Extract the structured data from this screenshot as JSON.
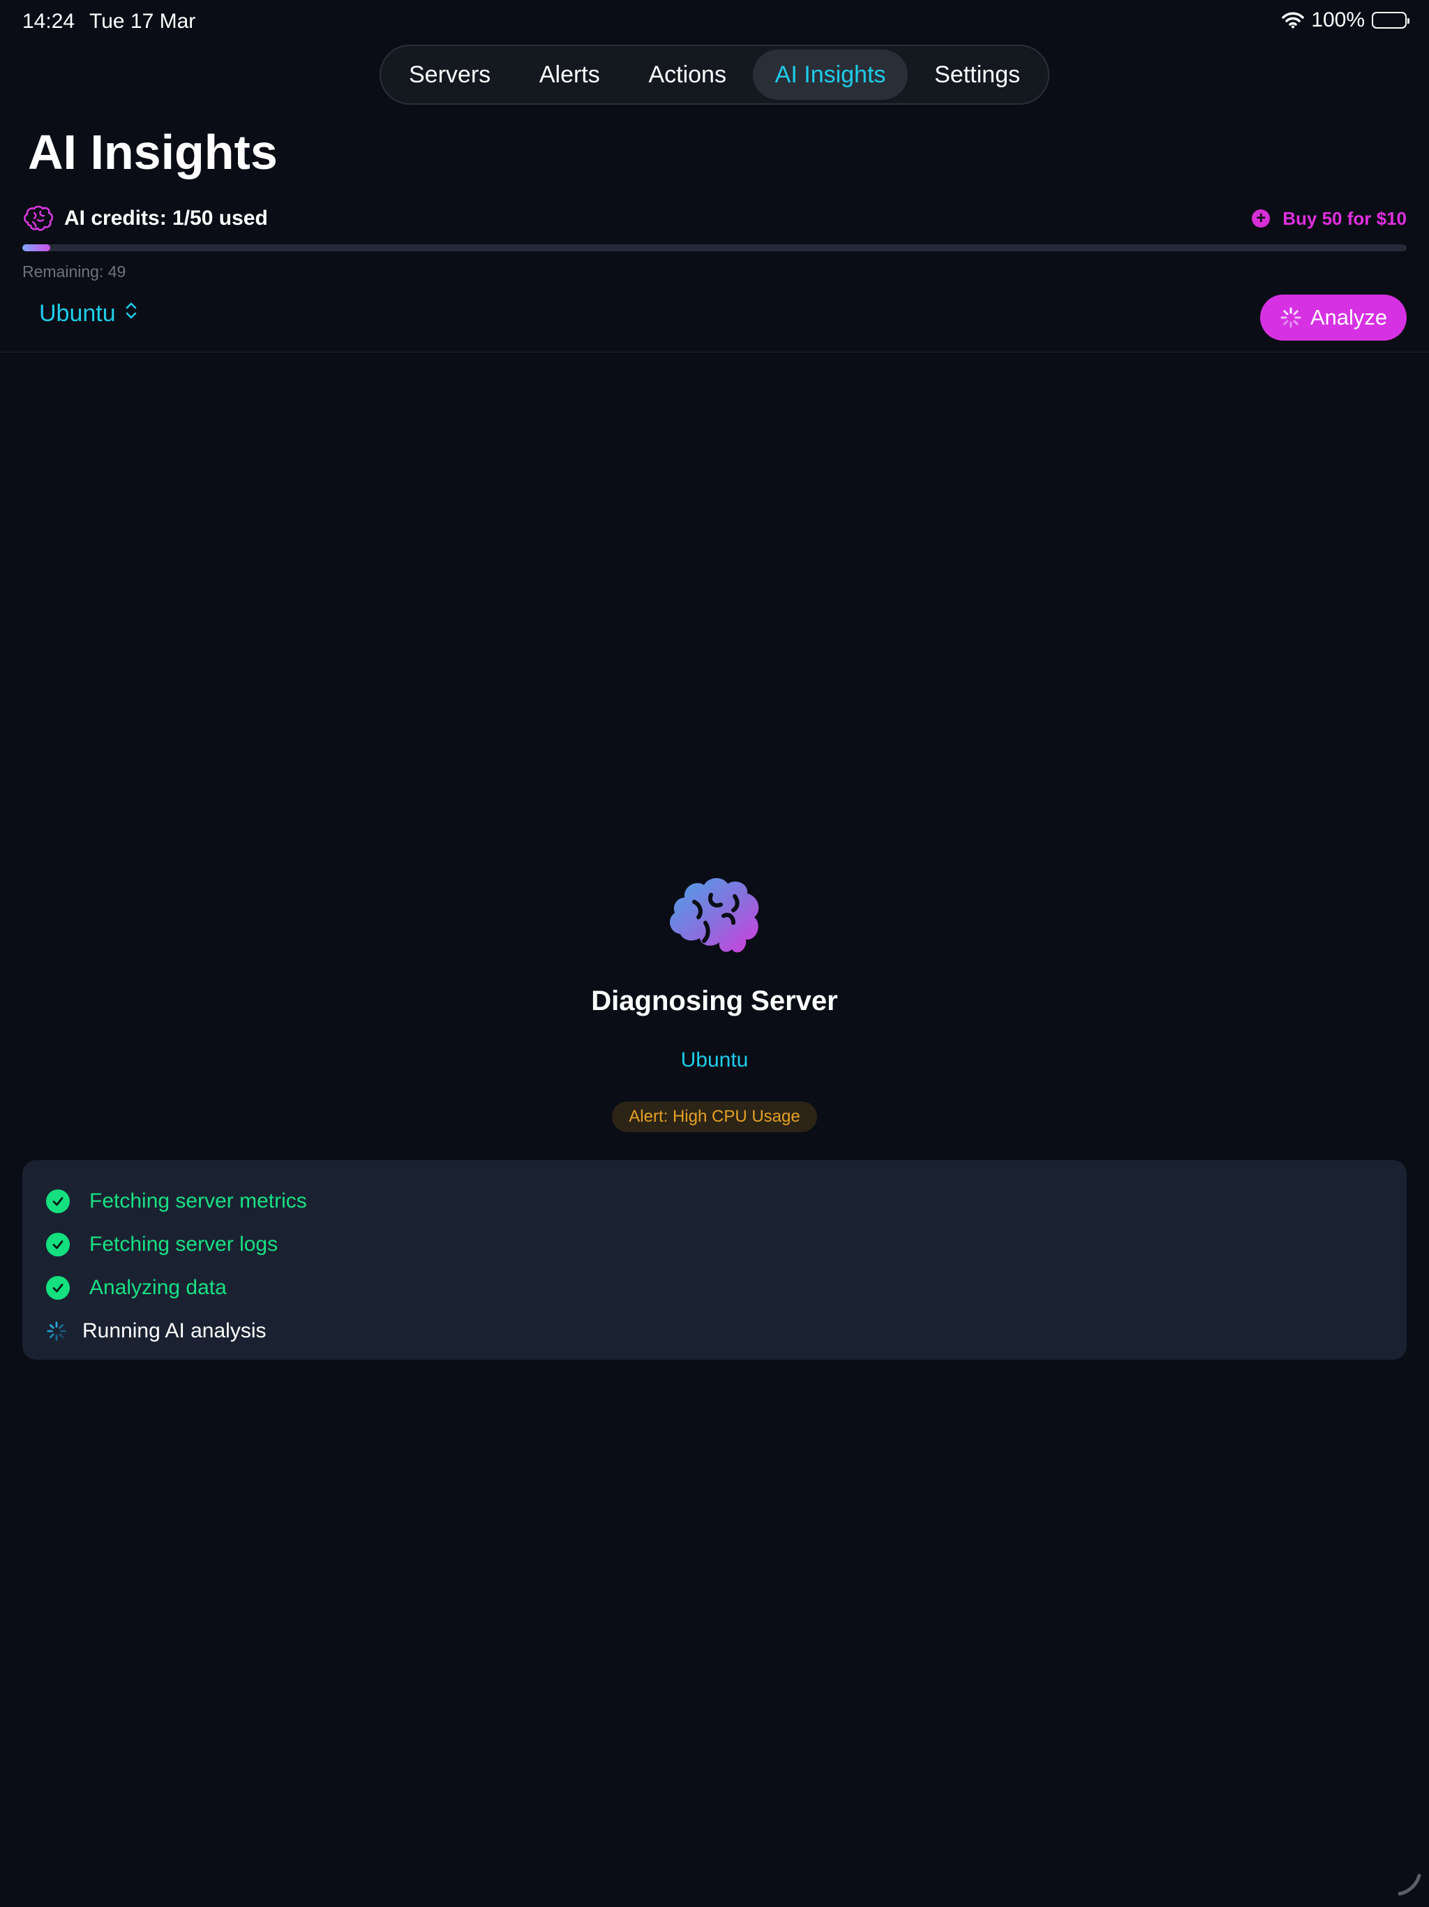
{
  "status_bar": {
    "time": "14:24",
    "date": "Tue 17 Mar",
    "battery": "100%"
  },
  "tabs": [
    {
      "label": "Servers",
      "active": false
    },
    {
      "label": "Alerts",
      "active": false
    },
    {
      "label": "Actions",
      "active": false
    },
    {
      "label": "AI Insights",
      "active": true
    },
    {
      "label": "Settings",
      "active": false
    }
  ],
  "page": {
    "title": "AI Insights"
  },
  "credits": {
    "label": "AI credits: 1/50 used",
    "buy_label": "Buy 50 for $10",
    "remaining": "Remaining: 49",
    "used": 1,
    "total": 50
  },
  "server_picker": {
    "selected": "Ubuntu"
  },
  "analyze_button": {
    "label": "Analyze"
  },
  "diagnosis": {
    "title": "Diagnosing Server",
    "server": "Ubuntu",
    "alert": "Alert: High CPU Usage"
  },
  "steps": [
    {
      "label": "Fetching server metrics",
      "status": "done"
    },
    {
      "label": "Fetching server logs",
      "status": "done"
    },
    {
      "label": "Analyzing data",
      "status": "done"
    },
    {
      "label": "Running AI analysis",
      "status": "running"
    }
  ],
  "colors": {
    "background": "#0a0d15",
    "accent_cyan": "#1ecdea",
    "accent_magenta": "#d631e3",
    "success_green": "#19e083",
    "alert_amber": "#e6a024",
    "card": "#1a2231"
  },
  "icons": {
    "wifi": "wifi-icon",
    "battery": "battery-icon",
    "credits": "brain-icon",
    "buy": "plus-circle-icon",
    "picker": "chevron-up-down-icon",
    "analyze": "spinner-icon",
    "hero": "brain-icon",
    "step_done": "check-circle-icon",
    "step_running": "spinner-icon"
  }
}
